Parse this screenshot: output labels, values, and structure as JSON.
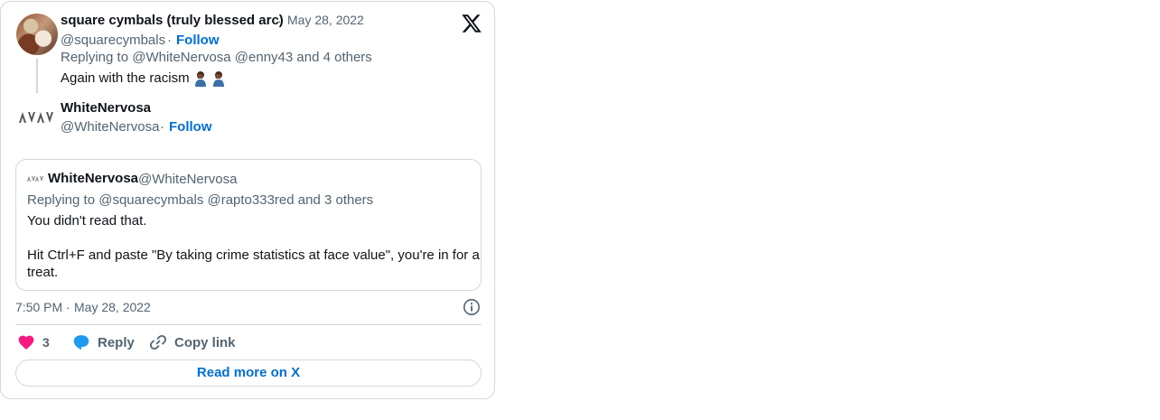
{
  "tweet": {
    "author_name": "square cymbals (truly blessed arc)",
    "dot": "·",
    "date": "May 28, 2022",
    "handle": "@squarecymbals",
    "follow_label": "Follow",
    "replying_to": "Replying to @WhiteNervosa @enny43 and 4 others",
    "body": "Again with the racism",
    "emoji": [
      "facepalm-icon",
      "facepalm-icon"
    ]
  },
  "parent": {
    "author_name": "WhiteNervosa",
    "handle": "@WhiteNervosa",
    "follow_label": "Follow"
  },
  "quote": {
    "author_name": "WhiteNervosa",
    "handle": "@WhiteNervosa",
    "replying_to": "Replying to @squarecymbals @rapto333red and 3 others",
    "line1": "You didn't read that.",
    "line2": "Hit Ctrl+F and paste \"By taking crime statistics at face value\", you're in for a",
    "line3": "treat."
  },
  "meta": {
    "time": "7:50 PM",
    "dot": "·",
    "date": "May 28, 2022"
  },
  "actions": {
    "like_count": "3",
    "reply_label": "Reply",
    "copy_label": "Copy link",
    "read_more_label": "Read more on X"
  },
  "colors": {
    "link": "#006fd6",
    "like": "#f91880",
    "reply": "#1d9bf0",
    "muted": "#536471",
    "border": "#cfd9de"
  }
}
